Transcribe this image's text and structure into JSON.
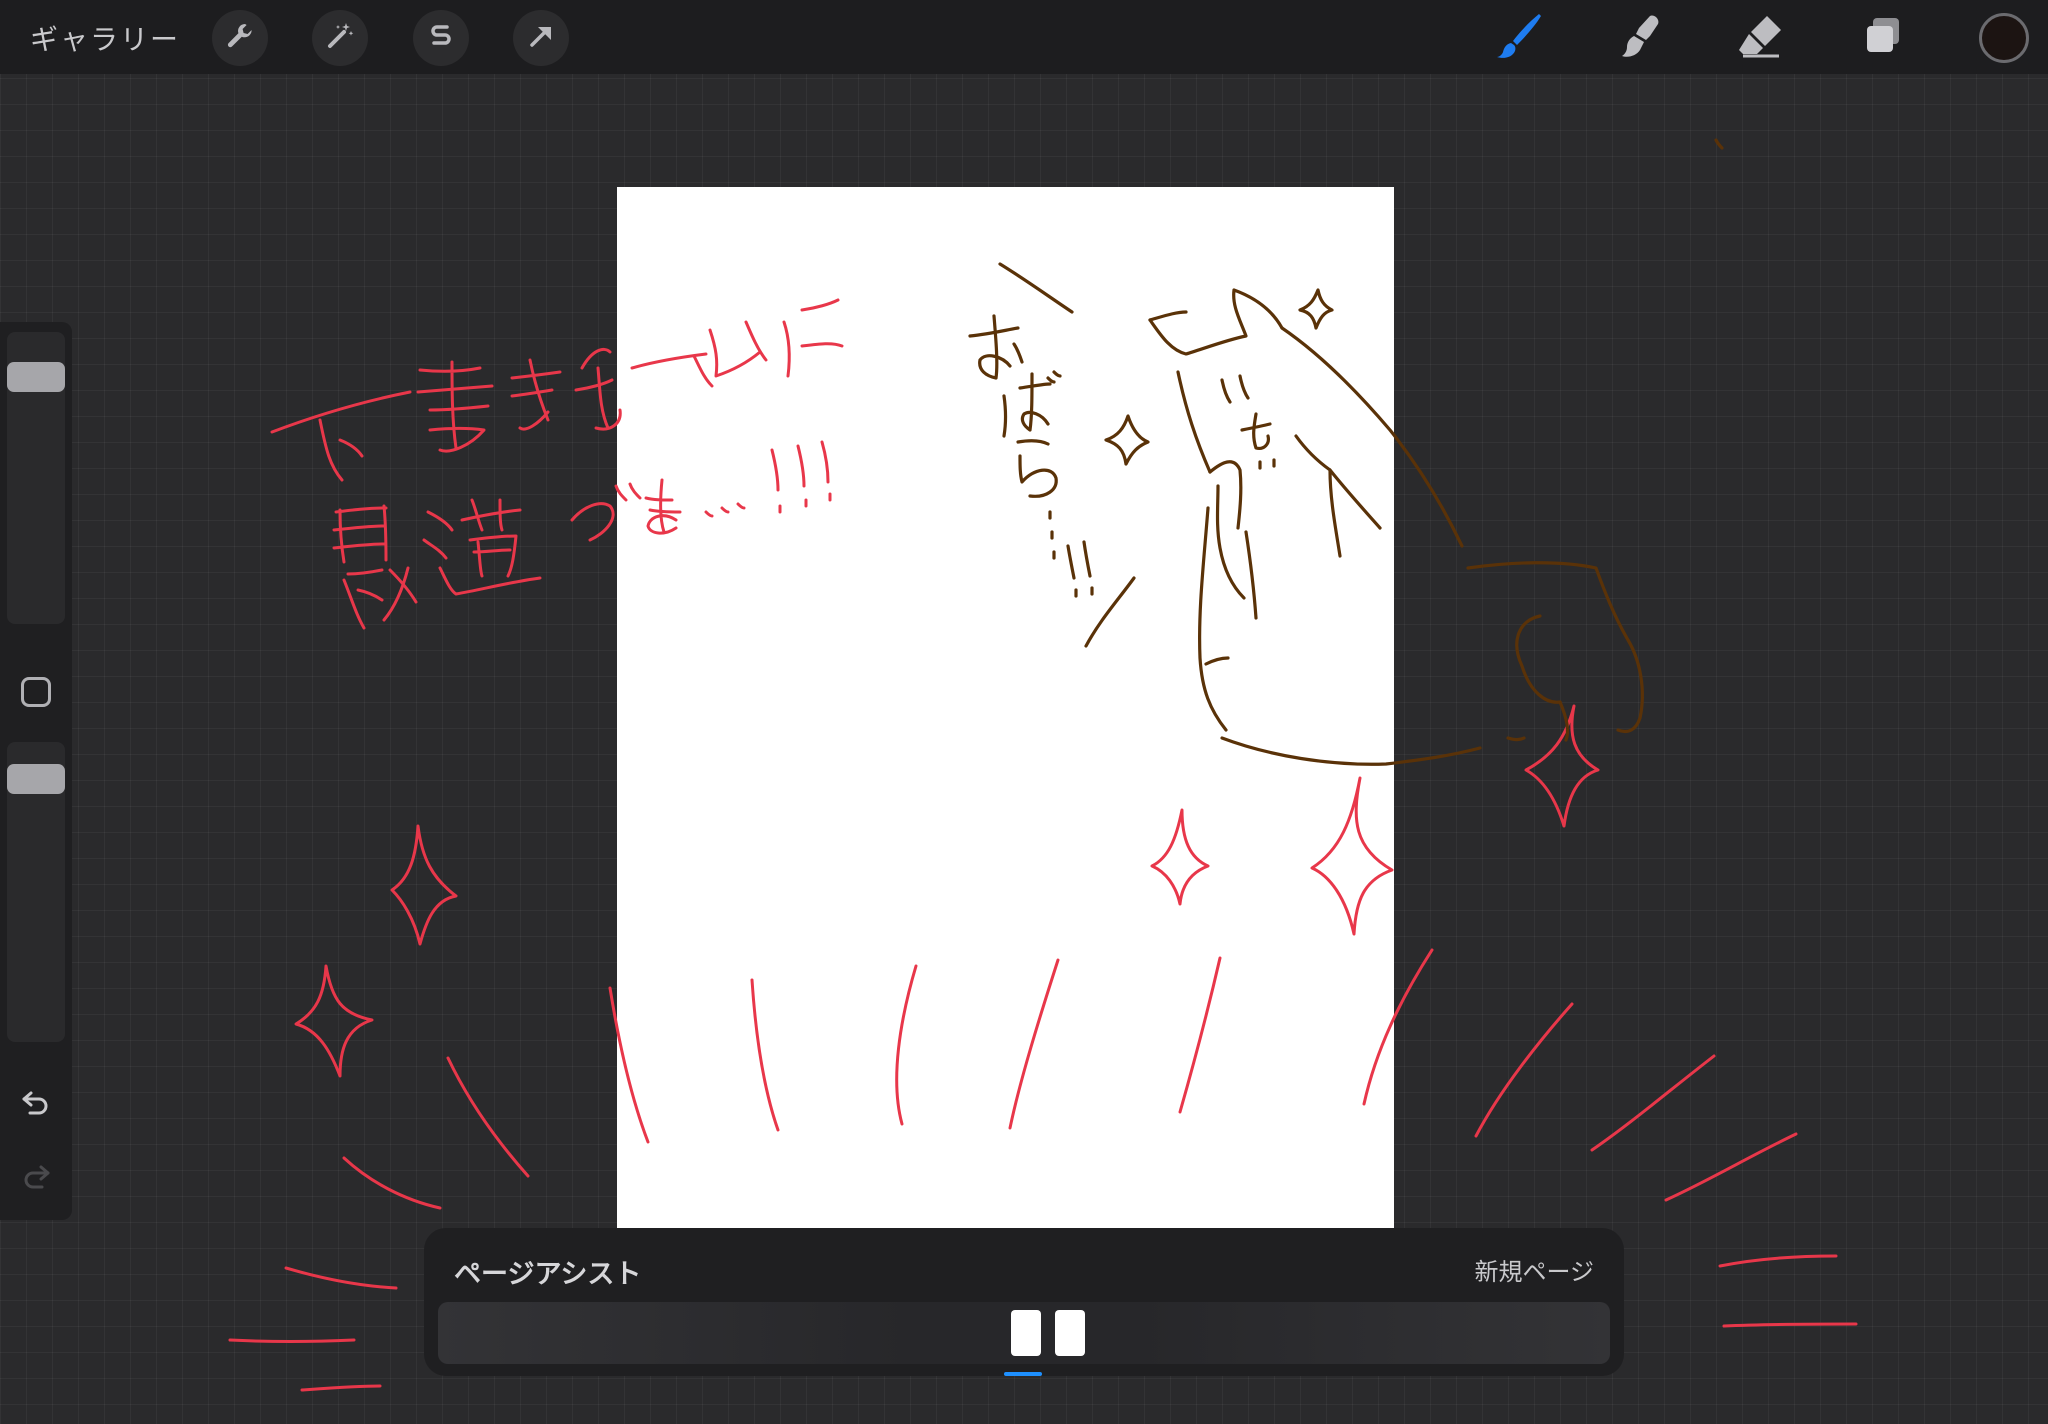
{
  "topbar": {
    "gallery_label": "ギャラリー",
    "left_tools": [
      "wrench-icon",
      "magic-wand-icon",
      "selection-icon",
      "transform-arrow-icon"
    ],
    "right_tools": [
      "brush-icon",
      "smudge-icon",
      "eraser-icon",
      "layers-icon"
    ],
    "brush_active_color": "#1e7cf0",
    "current_color": "#1c1412"
  },
  "sidebar": {
    "tools": [
      "size-slider",
      "modify-button",
      "opacity-slider",
      "undo-icon",
      "redo-icon"
    ]
  },
  "canvas": {
    "page_color": "#ffffff",
    "ink_red": "#e8374a",
    "ink_brown": "#5a3208"
  },
  "page_assist": {
    "title": "ページアシスト",
    "new_page_label": "新規ページ",
    "page_count": 2,
    "selected_indicator_color": "#1e90ff"
  }
}
